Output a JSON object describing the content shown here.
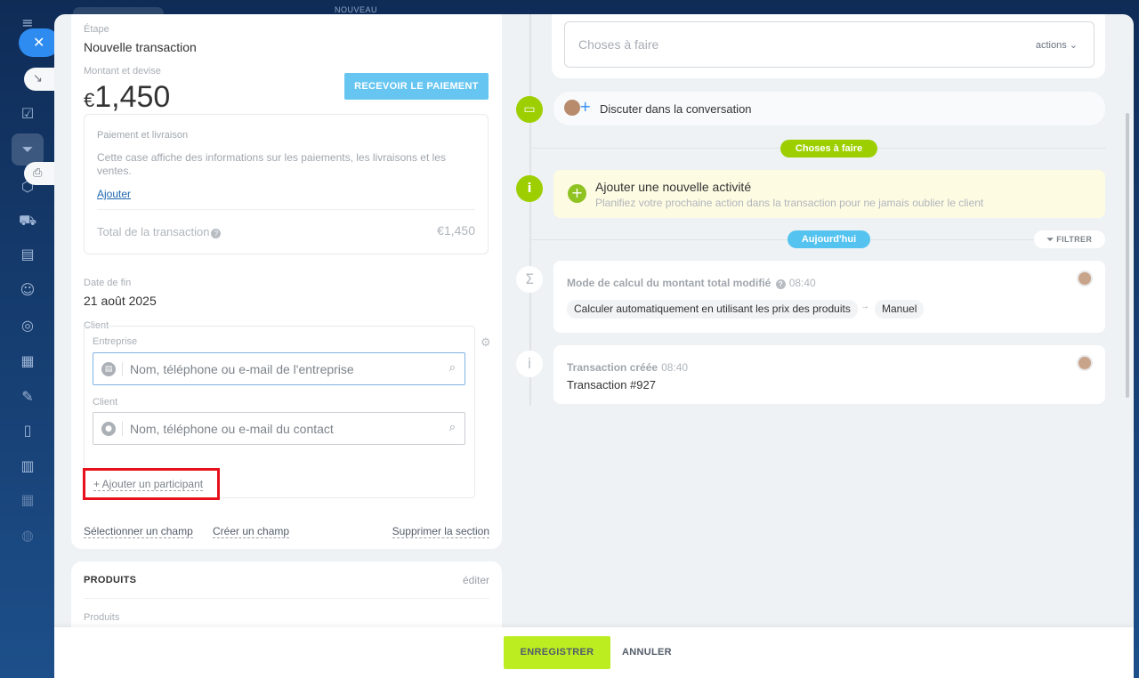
{
  "backdrop": {
    "top_label": "NOUVEAU"
  },
  "left": {
    "stage_label": "Étape",
    "stage_value": "Nouvelle transaction",
    "amount_label": "Montant et devise",
    "amount_currency": "€",
    "amount_value": "1,450",
    "receive_payment": "RECEVOIR LE PAIEMENT",
    "payment": {
      "title": "Paiement et livraison",
      "description": "Cette case affiche des informations sur les paiements, les livraisons et les ventes.",
      "add": "Ajouter",
      "total_label": "Total de la transaction",
      "total_value": "€1,450"
    },
    "end_date_label": "Date de fin",
    "end_date_value": "21 août 2025",
    "client_label": "Client",
    "company_label": "Entreprise",
    "company_placeholder": "Nom, téléphone ou e-mail de l'entreprise",
    "contact_label": "Client",
    "contact_placeholder": "Nom, téléphone ou e-mail du contact",
    "add_participant": "+ Ajouter un participant",
    "select_field": "Sélectionner un champ",
    "create_field": "Créer un champ",
    "delete_section": "Supprimer la section"
  },
  "products": {
    "title": "PRODUITS",
    "edit": "éditer",
    "label": "Produits"
  },
  "timeline": {
    "todo_placeholder": "Choses à faire",
    "todo_actions": "actions",
    "chat": "Discuter dans la conversation",
    "todo_badge": "Choses à faire",
    "new_activity_title": "Ajouter une nouvelle activité",
    "new_activity_sub": "Planifiez votre prochaine action dans la transaction pour ne jamais oublier le client",
    "today_badge": "Aujourd'hui",
    "filter": "FILTRER",
    "event1": {
      "title": "Mode de calcul du montant total modifié",
      "time": "08:40",
      "from": "Calculer automatiquement en utilisant les prix des produits",
      "to": "Manuel"
    },
    "event2": {
      "title": "Transaction créée",
      "time": "08:40",
      "body": "Transaction #927"
    }
  },
  "footer": {
    "save": "ENREGISTRER",
    "cancel": "ANNULER"
  }
}
